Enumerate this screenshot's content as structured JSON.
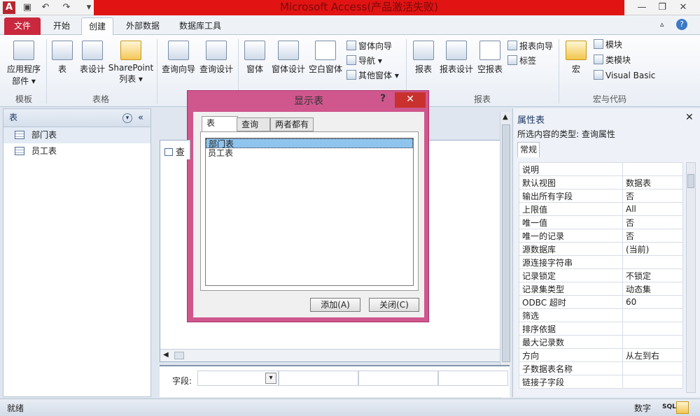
{
  "window": {
    "title": "Microsoft Access(产品激活失败)"
  },
  "quick_access": [
    "A",
    "save",
    "undo",
    "redo"
  ],
  "tabs": [
    "文件",
    "开始",
    "创建",
    "外部数据",
    "数据库工具"
  ],
  "ribbon": {
    "templates": {
      "app_parts": "应用程序",
      "app_parts2": "部件",
      "group": "模板"
    },
    "tables": {
      "table": "表",
      "table_design": "表设计",
      "sharepoint": "SharePoint",
      "sharepoint2": "列表",
      "group": "表格"
    },
    "queries": {
      "wizard": "查询向导",
      "design": "查询设计"
    },
    "forms": {
      "form": "窗体",
      "form_design": "窗体设计",
      "blank_form": "空白窗体",
      "form_wizard": "窗体向导",
      "navigation": "导航",
      "more_forms": "其他窗体"
    },
    "reports": {
      "report": "报表",
      "report_design": "报表设计",
      "blank_report": "空报表",
      "report_wizard": "报表向导",
      "labels": "标签",
      "group": "报表"
    },
    "macros": {
      "macro": "宏",
      "module": "模块",
      "class_module": "类模块",
      "vba": "Visual Basic",
      "group": "宏与代码"
    }
  },
  "nav": {
    "header": "表",
    "items": [
      "部门表",
      "员工表"
    ]
  },
  "query_tab": "查",
  "grid": {
    "field_label": "字段:"
  },
  "dialog": {
    "title": "显示表",
    "help": "?",
    "tabs": [
      "表",
      "查询",
      "两者都有"
    ],
    "items": [
      "部门表",
      "员工表"
    ],
    "selected": "部门表",
    "add": "添加(A)",
    "close": "关闭(C)"
  },
  "props": {
    "title": "属性表",
    "selection_type": "所选内容的类型: 查询属性",
    "tab": "常规",
    "rows": [
      [
        "说明",
        ""
      ],
      [
        "默认视图",
        "数据表"
      ],
      [
        "输出所有字段",
        "否"
      ],
      [
        "上限值",
        "All"
      ],
      [
        "唯一值",
        "否"
      ],
      [
        "唯一的记录",
        "否"
      ],
      [
        "源数据库",
        "(当前)"
      ],
      [
        "源连接字符串",
        ""
      ],
      [
        "记录锁定",
        "不锁定"
      ],
      [
        "记录集类型",
        "动态集"
      ],
      [
        "ODBC 超时",
        "60"
      ],
      [
        "筛选",
        ""
      ],
      [
        "排序依据",
        ""
      ],
      [
        "最大记录数",
        ""
      ],
      [
        "方向",
        "从左到右"
      ],
      [
        "子数据表名称",
        ""
      ],
      [
        "链接子字段",
        ""
      ]
    ]
  },
  "status": {
    "left": "就绪",
    "right": "数字",
    "sql": "SQL"
  }
}
